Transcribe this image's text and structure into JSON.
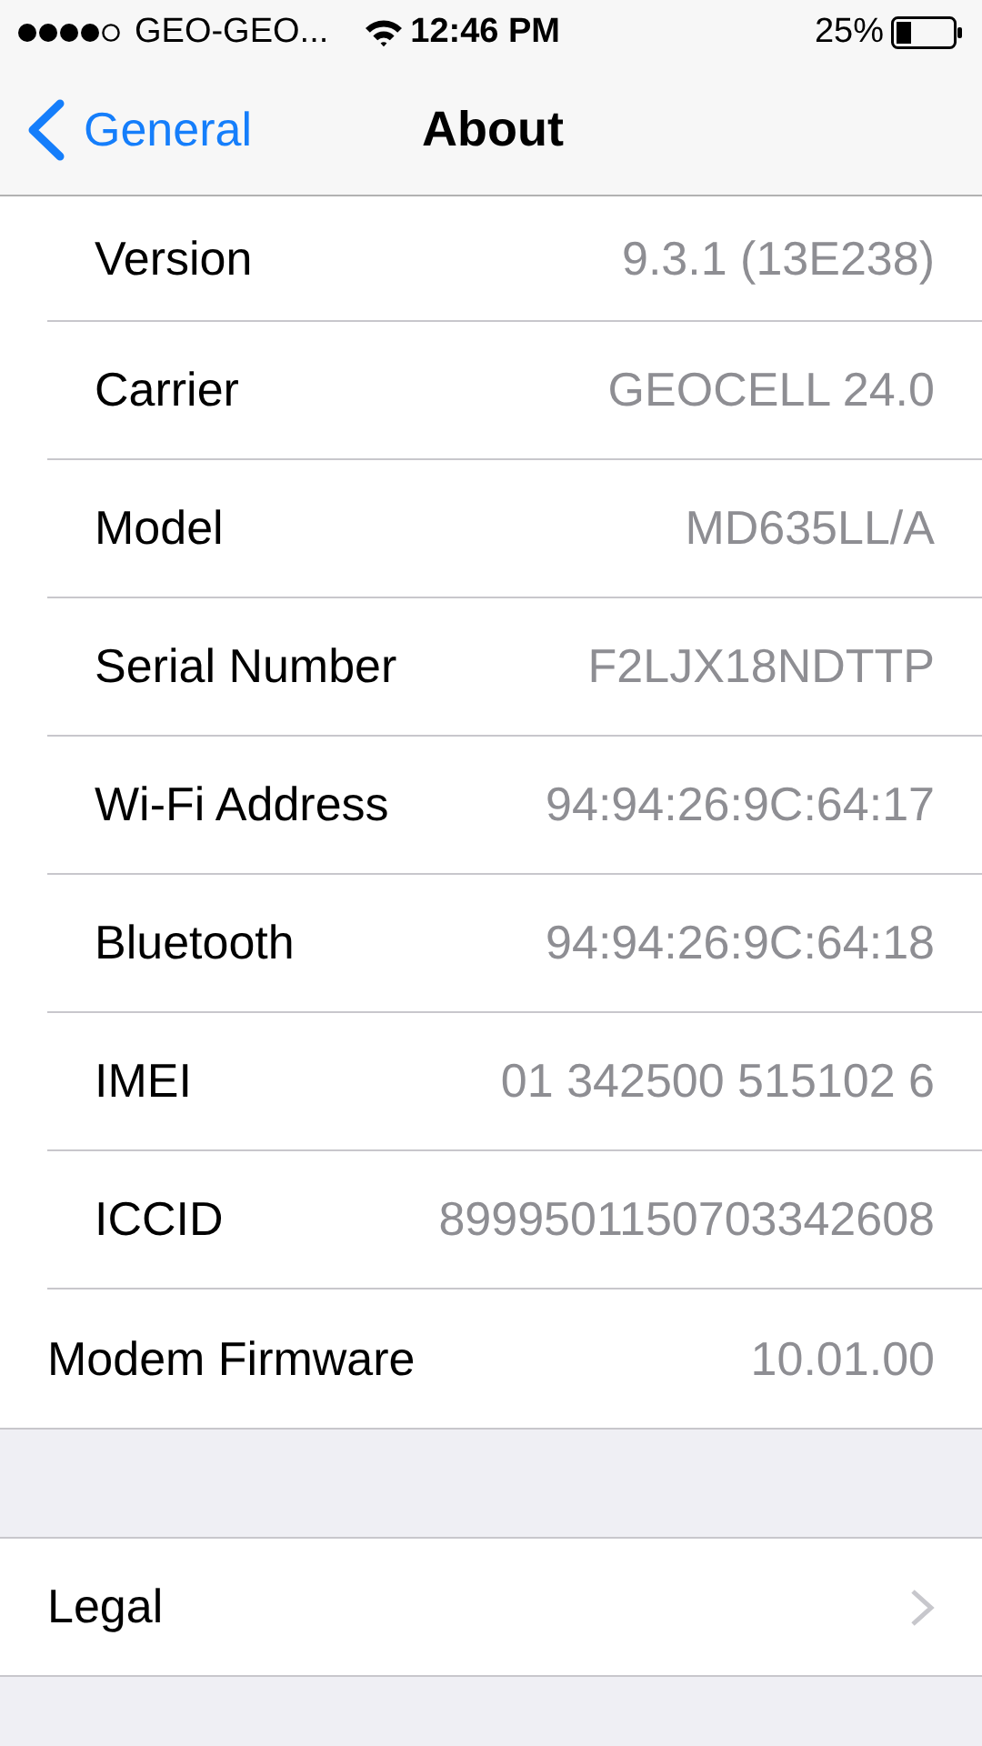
{
  "status_bar": {
    "carrier": "GEO-GEO...",
    "time": "12:46 PM",
    "battery": "25%"
  },
  "nav": {
    "back": "General",
    "title": "About"
  },
  "rows": [
    {
      "label": "Version",
      "value": "9.3.1 (13E238)"
    },
    {
      "label": "Carrier",
      "value": "GEOCELL 24.0"
    },
    {
      "label": "Model",
      "value": "MD635LL/A"
    },
    {
      "label": "Serial Number",
      "value": "F2LJX18NDTTP"
    },
    {
      "label": "Wi-Fi Address",
      "value": "94:94:26:9C:64:17"
    },
    {
      "label": "Bluetooth",
      "value": "94:94:26:9C:64:18"
    },
    {
      "label": "IMEI",
      "value": "01 342500 515102 6"
    },
    {
      "label": "ICCID",
      "value": "8999501150703342608"
    },
    {
      "label": "Modem Firmware",
      "value": "10.01.00"
    }
  ],
  "links": [
    {
      "label": "Legal"
    }
  ]
}
